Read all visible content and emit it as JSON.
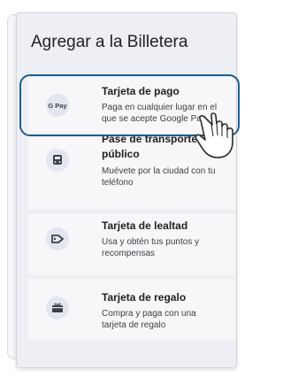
{
  "title": "Agregar a la Billetera",
  "cards": [
    {
      "icon": "google-pay-icon",
      "icon_text": "G Pay",
      "title": "Tarjeta de pago",
      "description_lines": [
        "Paga en cualquier lugar en el",
        "que se acepte Google Pay"
      ]
    },
    {
      "icon": "transit-pass-icon",
      "title_lines": [
        "Pase de transporte",
        "público"
      ],
      "description_lines": [
        "Muévete por la ciudad con tu",
        "teléfono"
      ]
    },
    {
      "icon": "loyalty-card-icon",
      "title": "Tarjeta de lealtad",
      "description_lines": [
        "Usa y obtén tus puntos y",
        "recompensas"
      ]
    },
    {
      "icon": "gift-card-icon",
      "title": "Tarjeta de regalo",
      "description_lines": [
        "Compra y paga con una",
        "tarjeta de regalo"
      ]
    }
  ],
  "colors": {
    "highlight": "#1b5f8f",
    "sheet": "#eeeff4",
    "card": "#f7f7fa"
  },
  "cursor_icon": "hand-pointer-icon"
}
